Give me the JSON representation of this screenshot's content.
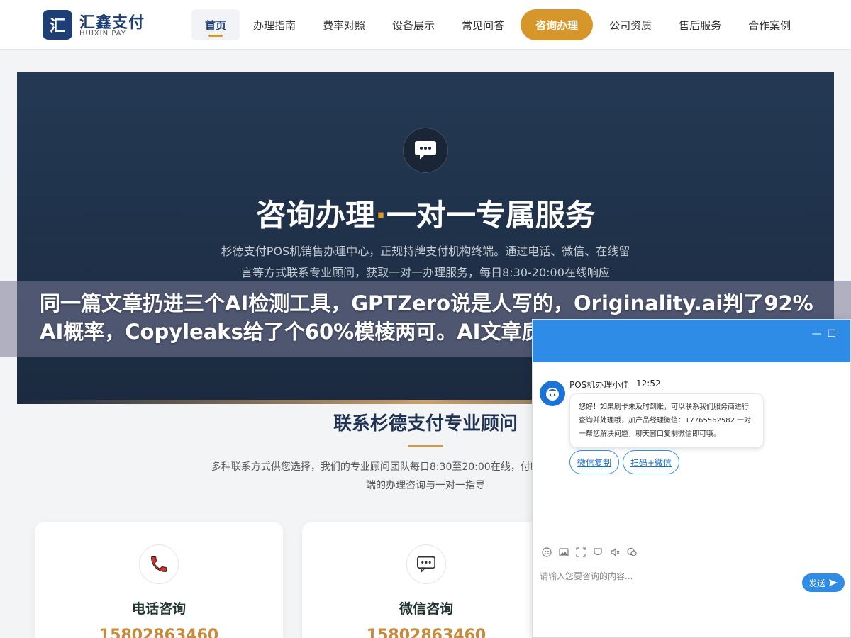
{
  "logo": {
    "mark": "汇",
    "name": "汇鑫支付",
    "sub": "HUIXIN PAY"
  },
  "nav": {
    "items": [
      {
        "label": "首页"
      },
      {
        "label": "办理指南"
      },
      {
        "label": "费率对照"
      },
      {
        "label": "设备展示"
      },
      {
        "label": "常见问答"
      },
      {
        "label": "咨询办理"
      },
      {
        "label": "公司资质"
      },
      {
        "label": "售后服务"
      },
      {
        "label": "合作案例"
      }
    ]
  },
  "hero": {
    "title_main": "咨询办理",
    "title_dot": "·",
    "title_rest": "一对一专属服务",
    "description": "杉德支付POS机销售办理中心，正规持牌支付机构终端。通过电话、微信、在线留言等方式联系专业顾问，获取一对一办理服务，每日8:30-20:00在线响应"
  },
  "section": {
    "title": "联系杉德支付专业顾问",
    "description": "多种联系方式供您选择，我们的专业顾问团队每日8:30至20:00在线，付POS机及杉德久付系列终端的办理咨询与一对一指导"
  },
  "cards": [
    {
      "title": "电话咨询",
      "value": "15802863460",
      "icon": "phone-icon"
    },
    {
      "title": "微信咨询",
      "value": "15802863460",
      "icon": "chat-bubble-icon"
    }
  ],
  "overlay": {
    "text": "同一篇文章扔进三个AI检测工具，GPTZero说是人写的，Originality.ai判了92%AI概率，Copyleaks给了个60%模棱两可。AI文章质量到底怎"
  },
  "chat": {
    "agent_name": "POS机办理小佳",
    "time": "12:52",
    "message": "您好！如果刷卡未及时到账，可以联系我们服务商进行查询并处理哦，加产品经理微信：17765562582 一对一帮您解决问题，聊天窗口复制微信即可哦。",
    "quick_buttons": [
      {
        "label": "微信复制"
      },
      {
        "label": "扫码+微信"
      }
    ],
    "input_placeholder": "请输入您要咨询的内容...",
    "send_label": "发送",
    "toolbar_icons": [
      "emoji-icon",
      "image-icon",
      "screenshot-icon",
      "rating-icon",
      "voice-icon",
      "chat-history-icon"
    ]
  },
  "colors": {
    "brand": "#1f3f74",
    "accent": "#d6962a",
    "chat_blue": "#2e8be6"
  }
}
